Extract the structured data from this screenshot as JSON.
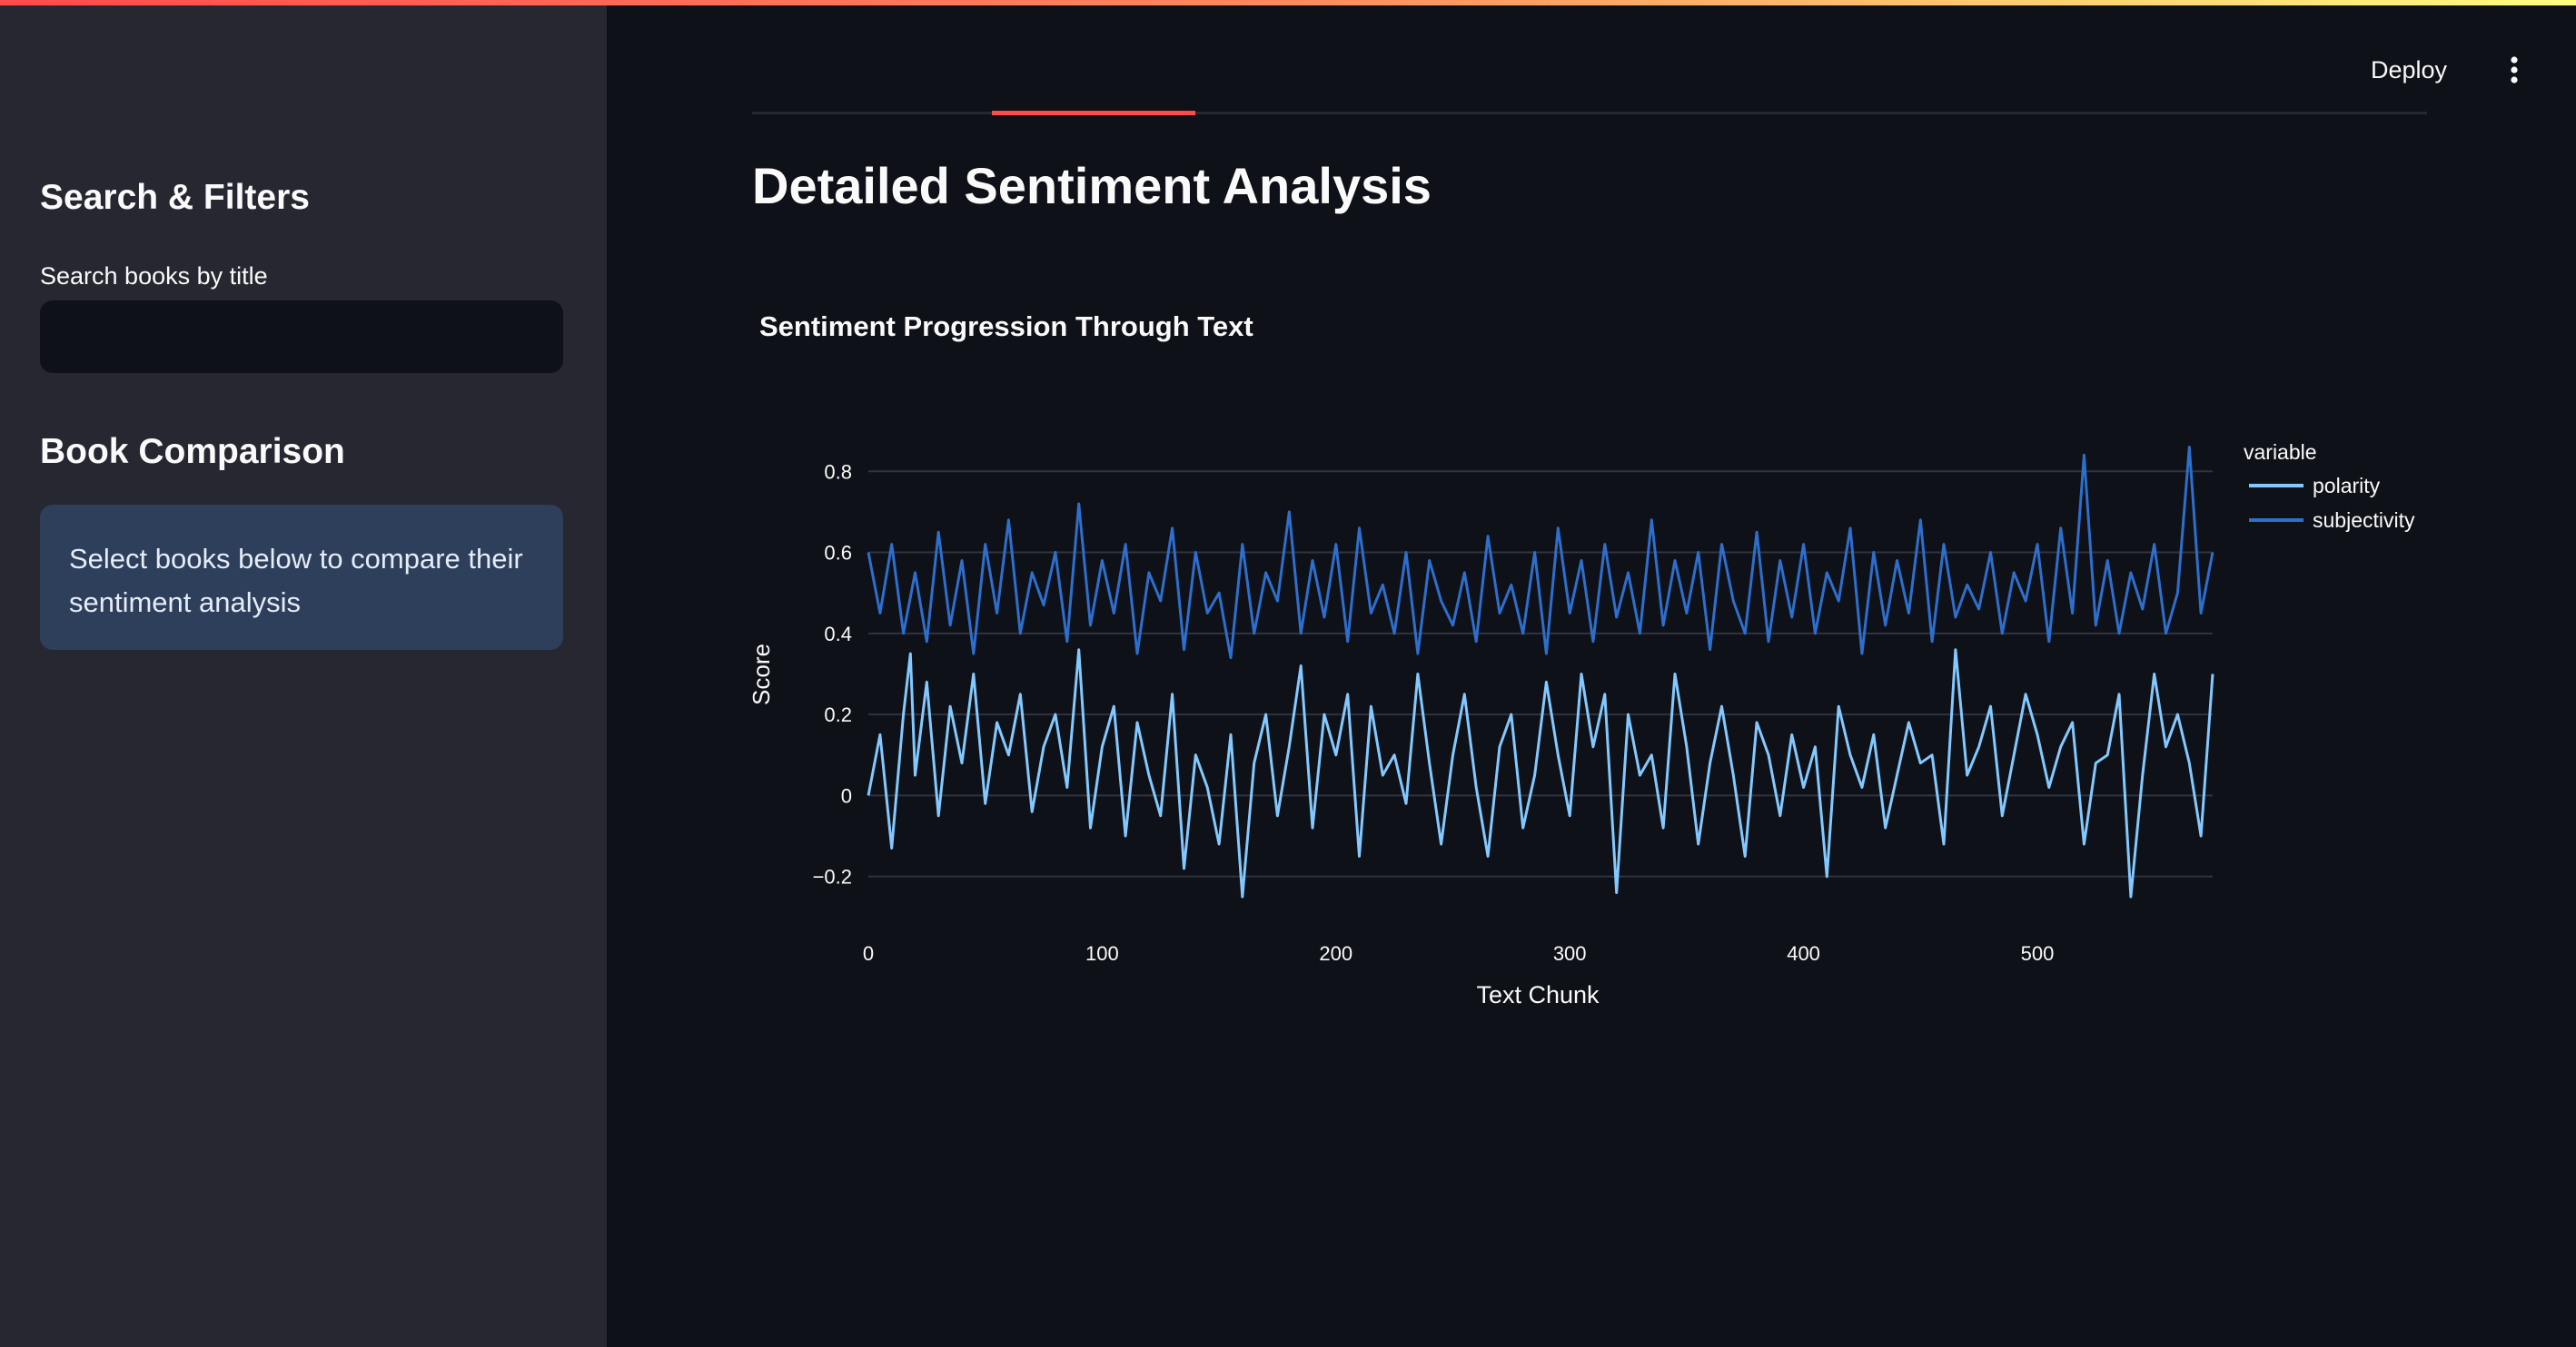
{
  "sidebar": {
    "search_heading": "Search & Filters",
    "search_label": "Search books by title",
    "search_value": "",
    "search_placeholder": "",
    "comparison_heading": "Book Comparison",
    "comparison_info": "Select books below to compare their sentiment analysis"
  },
  "header": {
    "deploy_label": "Deploy",
    "menu_icon": "vertical-ellipsis-icon"
  },
  "main": {
    "title": "Detailed Sentiment Analysis"
  },
  "colors": {
    "accent": "#ff4b4b",
    "polarity": "#83c9ff",
    "subjectivity": "#2e6ecc"
  },
  "chart_data": {
    "type": "line",
    "title": "Sentiment Progression Through Text",
    "xlabel": "Text Chunk",
    "ylabel": "Score",
    "xlim": [
      0,
      575
    ],
    "ylim": [
      -0.25,
      0.87
    ],
    "x_ticks": [
      0,
      100,
      200,
      300,
      400,
      500
    ],
    "y_ticks": [
      -0.2,
      0,
      0.2,
      0.4,
      0.6,
      0.8
    ],
    "y_tick_labels": [
      "−0.2",
      "0",
      "0.2",
      "0.4",
      "0.6",
      "0.8"
    ],
    "grid": true,
    "legend_title": "variable",
    "legend_position": "top-right",
    "series": [
      {
        "name": "polarity",
        "color": "#83c9ff",
        "x": [
          0,
          5,
          10,
          15,
          18,
          20,
          25,
          30,
          35,
          40,
          45,
          50,
          55,
          60,
          65,
          70,
          75,
          80,
          85,
          90,
          95,
          100,
          105,
          110,
          115,
          120,
          125,
          130,
          135,
          140,
          145,
          150,
          155,
          160,
          165,
          170,
          175,
          180,
          185,
          190,
          195,
          200,
          205,
          210,
          215,
          220,
          225,
          230,
          235,
          240,
          245,
          250,
          255,
          260,
          265,
          270,
          275,
          280,
          285,
          290,
          295,
          300,
          305,
          310,
          315,
          320,
          325,
          330,
          335,
          340,
          345,
          350,
          355,
          360,
          365,
          370,
          375,
          380,
          385,
          390,
          395,
          400,
          405,
          410,
          415,
          420,
          425,
          430,
          435,
          440,
          445,
          450,
          455,
          460,
          465,
          470,
          475,
          480,
          485,
          490,
          495,
          500,
          505,
          510,
          515,
          520,
          525,
          530,
          535,
          540,
          545,
          550,
          555,
          560,
          565,
          570,
          575
        ],
        "values": [
          0.0,
          0.15,
          -0.13,
          0.2,
          0.35,
          0.05,
          0.28,
          -0.05,
          0.22,
          0.08,
          0.3,
          -0.02,
          0.18,
          0.1,
          0.25,
          -0.04,
          0.12,
          0.2,
          0.02,
          0.36,
          -0.08,
          0.12,
          0.22,
          -0.1,
          0.18,
          0.05,
          -0.05,
          0.25,
          -0.18,
          0.1,
          0.02,
          -0.12,
          0.15,
          -0.25,
          0.08,
          0.2,
          -0.05,
          0.12,
          0.32,
          -0.08,
          0.2,
          0.1,
          0.25,
          -0.15,
          0.22,
          0.05,
          0.1,
          -0.02,
          0.3,
          0.08,
          -0.12,
          0.1,
          0.25,
          0.02,
          -0.15,
          0.12,
          0.2,
          -0.08,
          0.05,
          0.28,
          0.1,
          -0.05,
          0.3,
          0.12,
          0.25,
          -0.24,
          0.2,
          0.05,
          0.1,
          -0.08,
          0.3,
          0.12,
          -0.12,
          0.08,
          0.22,
          0.05,
          -0.15,
          0.18,
          0.1,
          -0.05,
          0.15,
          0.02,
          0.12,
          -0.2,
          0.22,
          0.1,
          0.02,
          0.15,
          -0.08,
          0.05,
          0.18,
          0.08,
          0.1,
          -0.12,
          0.36,
          0.05,
          0.12,
          0.22,
          -0.05,
          0.1,
          0.25,
          0.15,
          0.02,
          0.12,
          0.18,
          -0.12,
          0.08,
          0.1,
          0.25,
          -0.25,
          0.05,
          0.3,
          0.12,
          0.2,
          0.08,
          -0.1,
          0.3
        ],
        "line_width": 3
      },
      {
        "name": "subjectivity",
        "color": "#2e6ecc",
        "x": [
          0,
          5,
          10,
          15,
          20,
          25,
          30,
          35,
          40,
          45,
          50,
          55,
          60,
          65,
          70,
          75,
          80,
          85,
          90,
          95,
          100,
          105,
          110,
          115,
          120,
          125,
          130,
          135,
          140,
          145,
          150,
          155,
          160,
          165,
          170,
          175,
          180,
          185,
          190,
          195,
          200,
          205,
          210,
          215,
          220,
          225,
          230,
          235,
          240,
          245,
          250,
          255,
          260,
          265,
          270,
          275,
          280,
          285,
          290,
          295,
          300,
          305,
          310,
          315,
          320,
          325,
          330,
          335,
          340,
          345,
          350,
          355,
          360,
          365,
          370,
          375,
          380,
          385,
          390,
          395,
          400,
          405,
          410,
          415,
          420,
          425,
          430,
          435,
          440,
          445,
          450,
          455,
          460,
          465,
          470,
          475,
          480,
          485,
          490,
          495,
          500,
          505,
          510,
          515,
          520,
          525,
          530,
          535,
          540,
          545,
          550,
          555,
          560,
          565,
          570,
          575
        ],
        "values": [
          0.6,
          0.45,
          0.62,
          0.4,
          0.55,
          0.38,
          0.65,
          0.42,
          0.58,
          0.35,
          0.62,
          0.45,
          0.68,
          0.4,
          0.55,
          0.47,
          0.6,
          0.38,
          0.72,
          0.42,
          0.58,
          0.45,
          0.62,
          0.35,
          0.55,
          0.48,
          0.66,
          0.36,
          0.6,
          0.45,
          0.5,
          0.34,
          0.62,
          0.4,
          0.55,
          0.48,
          0.7,
          0.4,
          0.58,
          0.44,
          0.62,
          0.38,
          0.66,
          0.45,
          0.52,
          0.4,
          0.6,
          0.35,
          0.58,
          0.48,
          0.42,
          0.55,
          0.38,
          0.64,
          0.45,
          0.52,
          0.4,
          0.6,
          0.35,
          0.66,
          0.45,
          0.58,
          0.38,
          0.62,
          0.44,
          0.55,
          0.4,
          0.68,
          0.42,
          0.58,
          0.45,
          0.6,
          0.36,
          0.62,
          0.48,
          0.4,
          0.65,
          0.38,
          0.58,
          0.44,
          0.62,
          0.4,
          0.55,
          0.48,
          0.66,
          0.35,
          0.6,
          0.42,
          0.58,
          0.45,
          0.68,
          0.38,
          0.62,
          0.44,
          0.52,
          0.46,
          0.6,
          0.4,
          0.55,
          0.48,
          0.62,
          0.38,
          0.66,
          0.45,
          0.84,
          0.42,
          0.58,
          0.4,
          0.55,
          0.46,
          0.62,
          0.4,
          0.5,
          0.86,
          0.45,
          0.6
        ],
        "line_width": 3
      }
    ]
  }
}
